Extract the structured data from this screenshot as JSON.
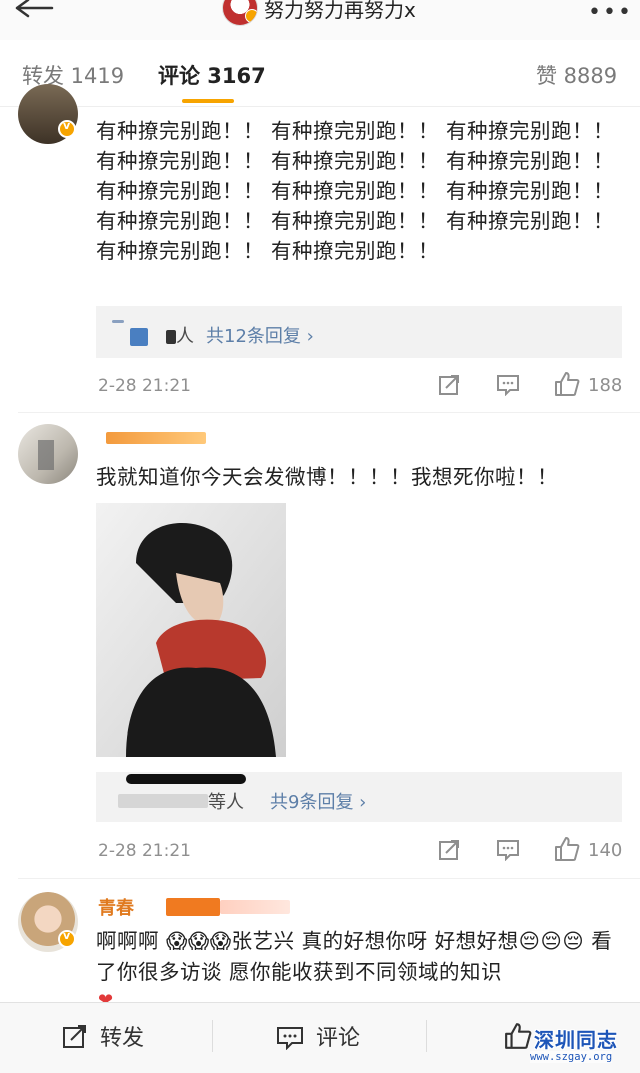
{
  "nav": {
    "title": "努力努力再努力x",
    "back_icon": "arrow-left-icon",
    "more_icon": "more-horizontal-icon",
    "more_glyph": "•••"
  },
  "tabs": {
    "repost": "转发 1419",
    "comments": "评论 3167",
    "likes": "赞 8889"
  },
  "comments": [
    {
      "text": "有种撩完别跑！！ 有种撩完别跑！！ 有种撩完别跑！！ 有种撩完别跑！！ 有种撩完别跑！！ 有种撩完别跑！！ 有种撩完别跑！！ 有种撩完别跑！！ 有种撩完别跑！！ 有种撩完别跑！！ 有种撩完别跑！！ 有种撩完别跑！！ 有种撩完别跑！！ 有种撩完别跑！！",
      "reply_prefix": "人",
      "reply_count": "共12条回复 ›",
      "time": "2-28 21:21",
      "likes": "188"
    },
    {
      "text": "我就知道你今天会发微博！！！！我想死你啦！！",
      "reply_prefix": "等人",
      "reply_count": "共9条回复 ›",
      "time": "2-28 21:21",
      "likes": "140"
    },
    {
      "name_visible": "青春",
      "text": "啊啊啊 😱😱😱张艺兴 真的好想你呀 好想好想😔😔😔 看了你很多访谈 愿你能收获到不同领域的知识"
    }
  ],
  "bottom": {
    "repost": "转发",
    "comment": "评论"
  },
  "watermark": {
    "main": "深圳同志",
    "url": "www.szgay.org"
  },
  "colors": {
    "accent": "#f7a400",
    "link": "#5d7fa8"
  }
}
